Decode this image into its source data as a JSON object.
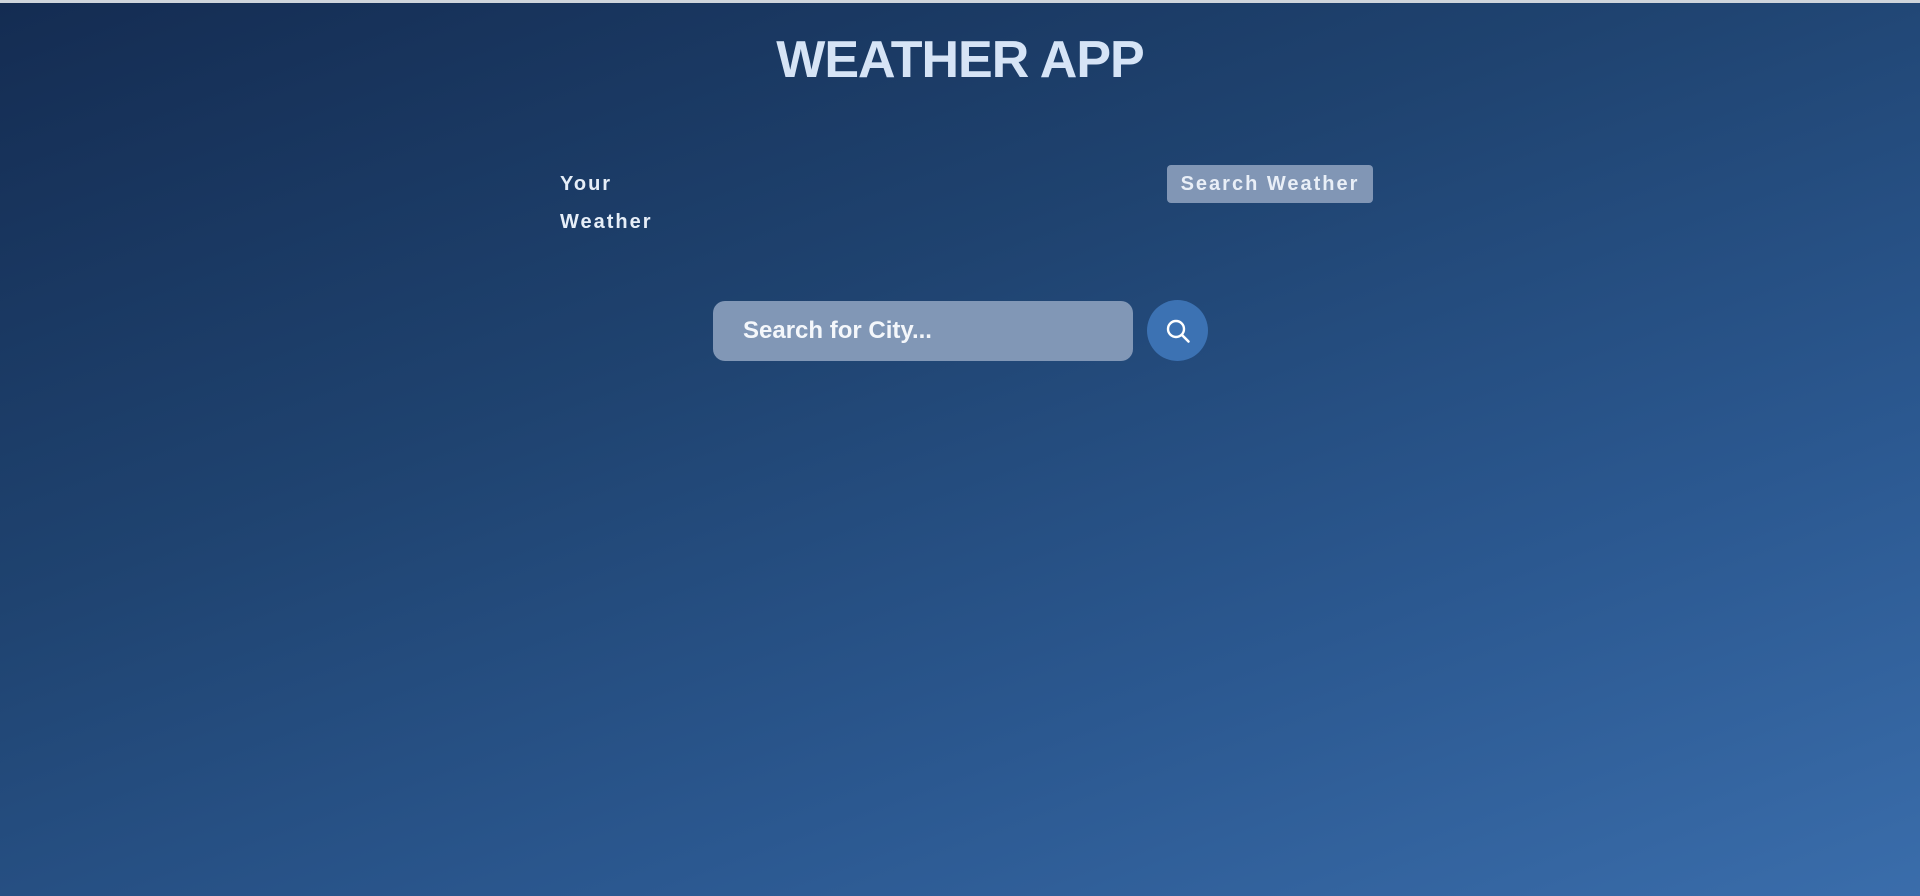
{
  "app": {
    "title": "WEATHER APP"
  },
  "tabs": [
    {
      "label": "Your Weather",
      "active": false
    },
    {
      "label": "Search Weather",
      "active": true
    }
  ],
  "search": {
    "placeholder": "Search for City...",
    "value": "",
    "button_icon": "search-icon"
  },
  "colors": {
    "background_start": "#142c52",
    "background_end": "#3a6dab",
    "title": "#d6e4f6",
    "active_tab_bg": "#8196b5",
    "input_bg": "#8197b6",
    "search_button_bg": "#3c72b3"
  }
}
